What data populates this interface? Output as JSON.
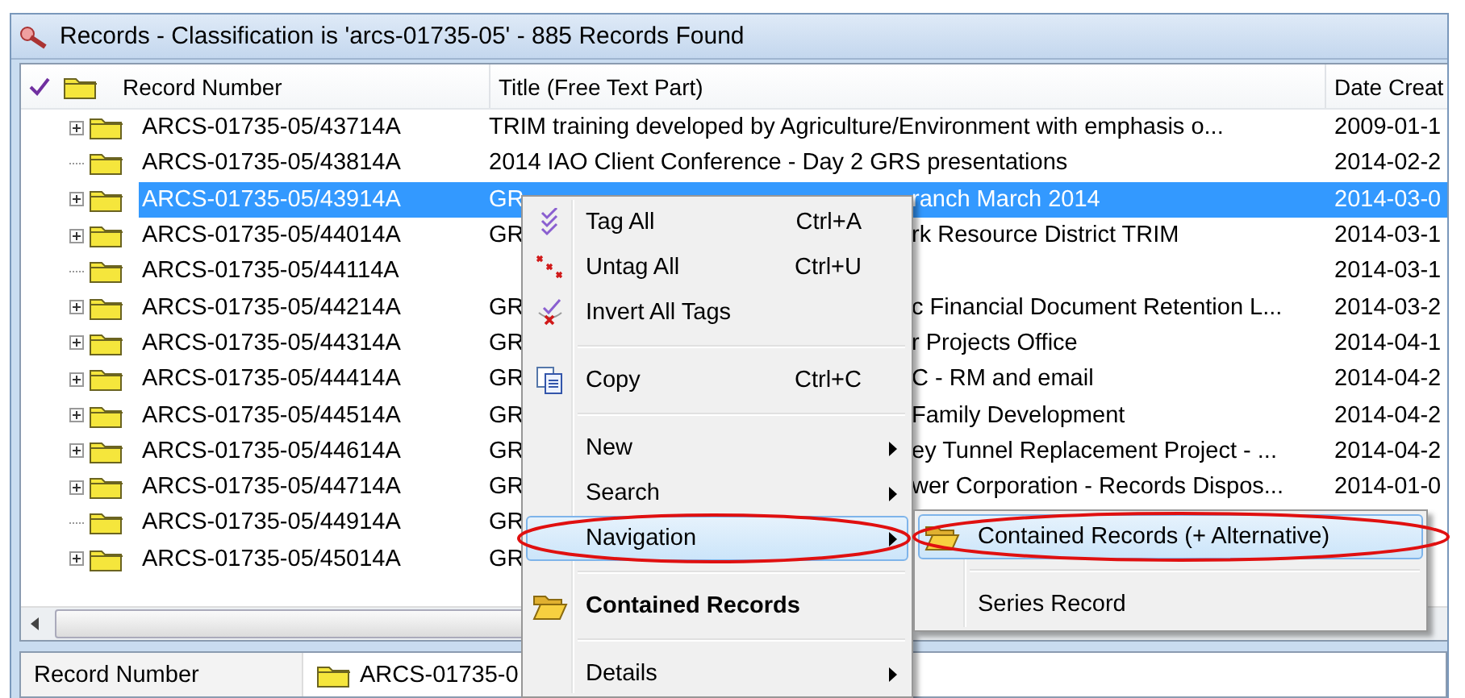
{
  "window": {
    "title": "Records - Classification is 'arcs-01735-05' - 885 Records Found"
  },
  "table": {
    "columns": [
      {
        "label": "Record Number"
      },
      {
        "label": "Title (Free Text Part)"
      },
      {
        "label": "Date Creat"
      }
    ],
    "rows": [
      {
        "number": "ARCS-01735-05/43714A",
        "expandable": true,
        "selected": false,
        "title": "TRIM training developed by Agriculture/Environment with emphasis o...",
        "date": "2009-01-1"
      },
      {
        "number": "ARCS-01735-05/43814A",
        "expandable": false,
        "selected": false,
        "title": "2014 IAO Client Conference - Day 2 GRS presentations",
        "date": "2014-02-2"
      },
      {
        "number": "ARCS-01735-05/43914A",
        "expandable": true,
        "selected": true,
        "title": "GR",
        "title_after": "ranch March 2014",
        "date": "2014-03-0"
      },
      {
        "number": "ARCS-01735-05/44014A",
        "expandable": true,
        "selected": false,
        "title": "GR",
        "title_after": "rk Resource District TRIM",
        "date": "2014-03-1"
      },
      {
        "number": "ARCS-01735-05/44114A",
        "expandable": false,
        "selected": false,
        "date": "2014-03-1"
      },
      {
        "number": "ARCS-01735-05/44214A",
        "expandable": true,
        "selected": false,
        "title": "GR",
        "title_after": "c Financial Document Retention L...",
        "date": "2014-03-2"
      },
      {
        "number": "ARCS-01735-05/44314A",
        "expandable": true,
        "selected": false,
        "title": "GR",
        "title_after": "r Projects Office",
        "date": "2014-04-1"
      },
      {
        "number": "ARCS-01735-05/44414A",
        "expandable": true,
        "selected": false,
        "title": "GR",
        "title_after": "C - RM and email",
        "date": "2014-04-2"
      },
      {
        "number": "ARCS-01735-05/44514A",
        "expandable": true,
        "selected": false,
        "title": "GR",
        "title_after": "Family Development",
        "date": "2014-04-2"
      },
      {
        "number": "ARCS-01735-05/44614A",
        "expandable": true,
        "selected": false,
        "title": "GR",
        "title_after": "ey Tunnel Replacement Project - ...",
        "date": "2014-04-2"
      },
      {
        "number": "ARCS-01735-05/44714A",
        "expandable": true,
        "selected": false,
        "title": "GR",
        "title_after": "wer Corporation - Records Dispos...",
        "date": "2014-01-0"
      },
      {
        "number": "ARCS-01735-05/44914A",
        "expandable": false,
        "selected": false,
        "title": "GR"
      },
      {
        "number": "ARCS-01735-05/45014A",
        "expandable": true,
        "selected": false,
        "title": "GR"
      }
    ]
  },
  "detail": {
    "label": "Record Number",
    "value": "ARCS-01735-0"
  },
  "context_menu": {
    "items": [
      {
        "kind": "command",
        "label": "Tag All",
        "shortcut": "Ctrl+A",
        "selected": false,
        "bold": false,
        "circled": false
      },
      {
        "kind": "command",
        "label": "Untag All",
        "shortcut": "Ctrl+U",
        "selected": false,
        "bold": false,
        "circled": false
      },
      {
        "kind": "command",
        "label": "Invert All Tags",
        "selected": false,
        "bold": false,
        "circled": false
      },
      {
        "kind": "separator"
      },
      {
        "kind": "command",
        "label": "Copy",
        "shortcut": "Ctrl+C",
        "selected": false,
        "bold": false,
        "circled": false
      },
      {
        "kind": "separator"
      },
      {
        "kind": "submenu",
        "label": "New",
        "selected": false,
        "bold": false,
        "circled": false
      },
      {
        "kind": "submenu",
        "label": "Search",
        "selected": false,
        "bold": false,
        "circled": false
      },
      {
        "kind": "submenu",
        "label": "Navigation",
        "selected": true,
        "bold": false,
        "circled": true
      },
      {
        "kind": "separator"
      },
      {
        "kind": "command",
        "label": "Contained Records",
        "selected": false,
        "bold": true,
        "circled": false
      },
      {
        "kind": "separator"
      },
      {
        "kind": "submenu",
        "label": "Details",
        "selected": false,
        "bold": false,
        "circled": false
      }
    ]
  },
  "submenu": {
    "items": [
      {
        "kind": "command",
        "label": "Contained Records (+ Alternative)",
        "selected": true,
        "bold": false,
        "circled": true
      },
      {
        "kind": "separator"
      },
      {
        "kind": "command",
        "label": "Series Record",
        "selected": false,
        "bold": false,
        "circled": false
      }
    ]
  }
}
